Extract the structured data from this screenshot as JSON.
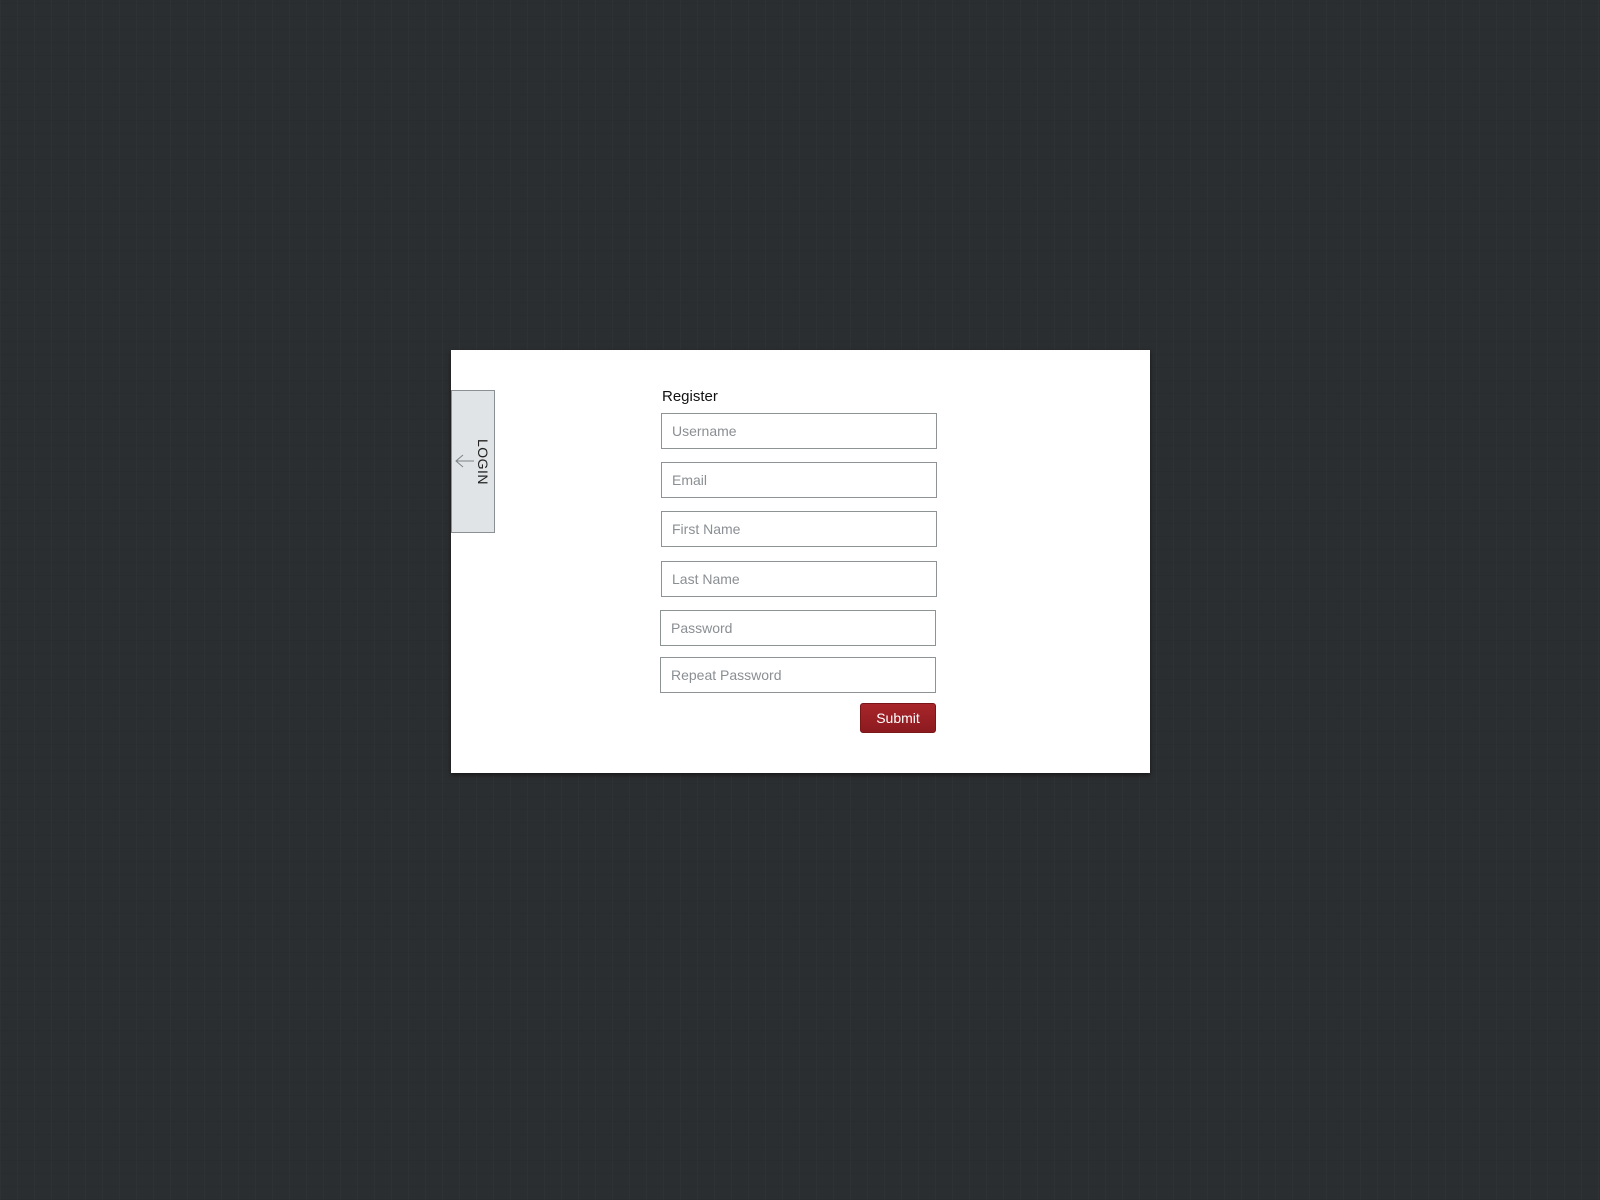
{
  "colors": {
    "background": "#2b2e30",
    "panel": "#ffffff",
    "tab": "#e0e4e6",
    "submit": "#9b2126"
  },
  "login_tab": {
    "label": "LOGIN",
    "icon": "arrow-left-icon"
  },
  "register": {
    "title": "Register",
    "fields": {
      "username": {
        "placeholder": "Username",
        "value": ""
      },
      "email": {
        "placeholder": "Email",
        "value": ""
      },
      "first_name": {
        "placeholder": "First Name",
        "value": ""
      },
      "last_name": {
        "placeholder": "Last Name",
        "value": ""
      },
      "password": {
        "placeholder": "Password",
        "value": ""
      },
      "repeat_password": {
        "placeholder": "Repeat Password",
        "value": ""
      }
    },
    "submit_label": "Submit"
  }
}
